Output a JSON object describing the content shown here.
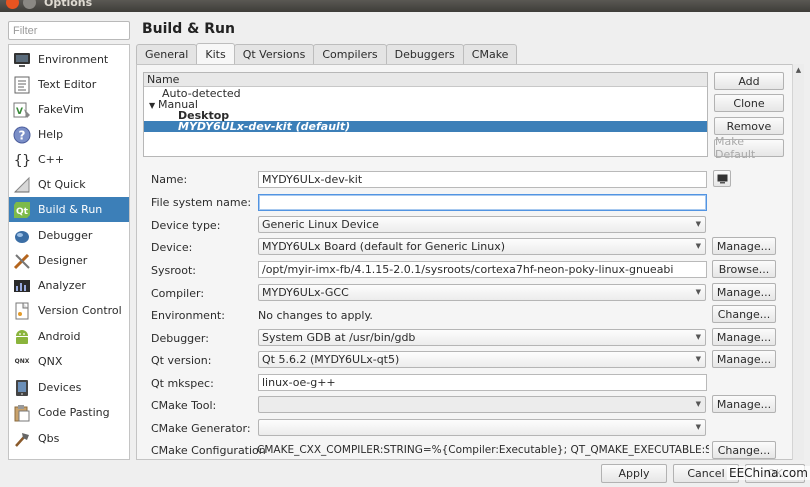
{
  "window": {
    "title": "Options"
  },
  "filter": {
    "placeholder": "Filter"
  },
  "sidebar": {
    "items": [
      {
        "label": "Environment",
        "icon": "monitor-icon"
      },
      {
        "label": "Text Editor",
        "icon": "text-editor-icon"
      },
      {
        "label": "FakeVim",
        "icon": "fakevim-icon"
      },
      {
        "label": "Help",
        "icon": "help-icon"
      },
      {
        "label": "C++",
        "icon": "braces-icon"
      },
      {
        "label": "Qt Quick",
        "icon": "qt-quick-icon"
      },
      {
        "label": "Build & Run",
        "icon": "qt-logo-icon",
        "active": true
      },
      {
        "label": "Debugger",
        "icon": "debugger-icon"
      },
      {
        "label": "Designer",
        "icon": "designer-icon"
      },
      {
        "label": "Analyzer",
        "icon": "analyzer-icon"
      },
      {
        "label": "Version Control",
        "icon": "version-control-icon"
      },
      {
        "label": "Android",
        "icon": "android-icon"
      },
      {
        "label": "QNX",
        "icon": "qnx-icon",
        "icon_text": "QNX"
      },
      {
        "label": "Devices",
        "icon": "devices-icon"
      },
      {
        "label": "Code Pasting",
        "icon": "code-pasting-icon"
      },
      {
        "label": "Qbs",
        "icon": "qbs-icon"
      }
    ]
  },
  "page": {
    "title": "Build & Run"
  },
  "tabs": [
    {
      "label": "General"
    },
    {
      "label": "Kits",
      "active": true
    },
    {
      "label": "Qt Versions"
    },
    {
      "label": "Compilers"
    },
    {
      "label": "Debuggers"
    },
    {
      "label": "CMake"
    }
  ],
  "kits_tree": {
    "header": "Name",
    "rows": [
      {
        "label": "Auto-detected",
        "indent": 1
      },
      {
        "label": "Manual",
        "indent": 0,
        "expanded": true
      },
      {
        "label": "Desktop",
        "indent": 2,
        "bold": true
      },
      {
        "label": "MYDY6ULx-dev-kit (default)",
        "indent": 2,
        "selected": true
      }
    ]
  },
  "kit_buttons": {
    "add": "Add",
    "clone": "Clone",
    "remove": "Remove",
    "make_default": "Make Default"
  },
  "form": {
    "name": {
      "label": "Name:",
      "value": "MYDY6ULx-dev-kit"
    },
    "fs_name": {
      "label": "File system name:",
      "value": ""
    },
    "device_type": {
      "label": "Device type:",
      "value": "Generic Linux Device"
    },
    "device": {
      "label": "Device:",
      "value": "MYDY6ULx Board (default for Generic Linux)",
      "button": "Manage..."
    },
    "sysroot": {
      "label": "Sysroot:",
      "value": "/opt/myir-imx-fb/4.1.15-2.0.1/sysroots/cortexa7hf-neon-poky-linux-gnueabi",
      "button": "Browse..."
    },
    "compiler": {
      "label": "Compiler:",
      "value": "MYDY6ULx-GCC",
      "button": "Manage..."
    },
    "environment": {
      "label": "Environment:",
      "value": "No changes to apply.",
      "button": "Change..."
    },
    "debugger": {
      "label": "Debugger:",
      "value": "System GDB at /usr/bin/gdb",
      "button": "Manage..."
    },
    "qt_version": {
      "label": "Qt version:",
      "value": "Qt 5.6.2 (MYDY6ULx-qt5)",
      "button": "Manage..."
    },
    "qt_mkspec": {
      "label": "Qt mkspec:",
      "value": "linux-oe-g++"
    },
    "cmake_tool": {
      "label": "CMake Tool:",
      "value": "",
      "button": "Manage..."
    },
    "cmake_generator": {
      "label": "CMake Generator:",
      "value": ""
    },
    "cmake_config": {
      "label": "CMake Configuration",
      "value": "CMAKE_CXX_COMPILER:STRING=%{Compiler:Executable}; QT_QMAKE_EXECUTABLE:STRIN...",
      "button": "Change..."
    }
  },
  "bottom": {
    "apply": "Apply",
    "cancel": "Cancel",
    "ok": "OK"
  },
  "watermark": "EEChina.com",
  "colors": {
    "accent": "#3c7fb8",
    "close_button": "#e95420"
  }
}
